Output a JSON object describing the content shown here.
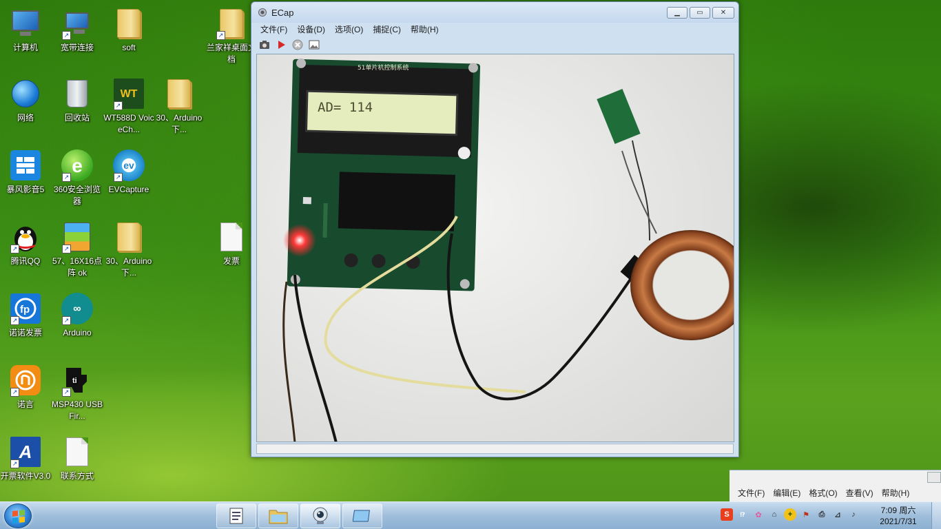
{
  "desktop": {
    "icons": [
      {
        "label": "计算机"
      },
      {
        "label": "宽带连接"
      },
      {
        "label": "soft"
      },
      {
        "label": "兰家祥桌面文档"
      },
      {
        "label": "网络"
      },
      {
        "label": "回收站"
      },
      {
        "label": "WT588D VoiceCh..."
      },
      {
        "label": "30、Arduino下..."
      },
      {
        "label": "暴风影音5"
      },
      {
        "label": "360安全浏览器"
      },
      {
        "label": "EVCapture"
      },
      {
        "label": "腾讯QQ"
      },
      {
        "label": "57、16X16点阵 ok"
      },
      {
        "label": "30、Arduino下..."
      },
      {
        "label": "发票"
      },
      {
        "label": "诺诺发票"
      },
      {
        "label": "Arduino"
      },
      {
        "label": "诺言"
      },
      {
        "label": "MSP430 USB Fir..."
      },
      {
        "label": "开票软件V3.0"
      },
      {
        "label": "联系方式"
      }
    ]
  },
  "window": {
    "title": "ECap",
    "menu": [
      "文件(F)",
      "设备(D)",
      "选项(O)",
      "捕捉(C)",
      "帮助(H)"
    ],
    "toolbar": [
      "camera-icon",
      "play-icon",
      "stop-icon",
      "image-icon"
    ],
    "camera": {
      "lcd_text": "AD= 114",
      "pcb_title": "51单片机控制系统"
    }
  },
  "notepad": {
    "menu": [
      "文件(F)",
      "编辑(E)",
      "格式(O)",
      "查看(V)",
      "帮助(H)"
    ]
  },
  "taskbar": {
    "items": [
      "notepad-task",
      "explorer-task",
      "ecap-task",
      "media-task"
    ],
    "clock": {
      "time": "7:09 周六",
      "date": "2021/7/31"
    }
  },
  "colors": {
    "window_frame": "#cfe0f1",
    "taskbar": "#9fbedb",
    "accent_red": "#ff2a2a"
  }
}
